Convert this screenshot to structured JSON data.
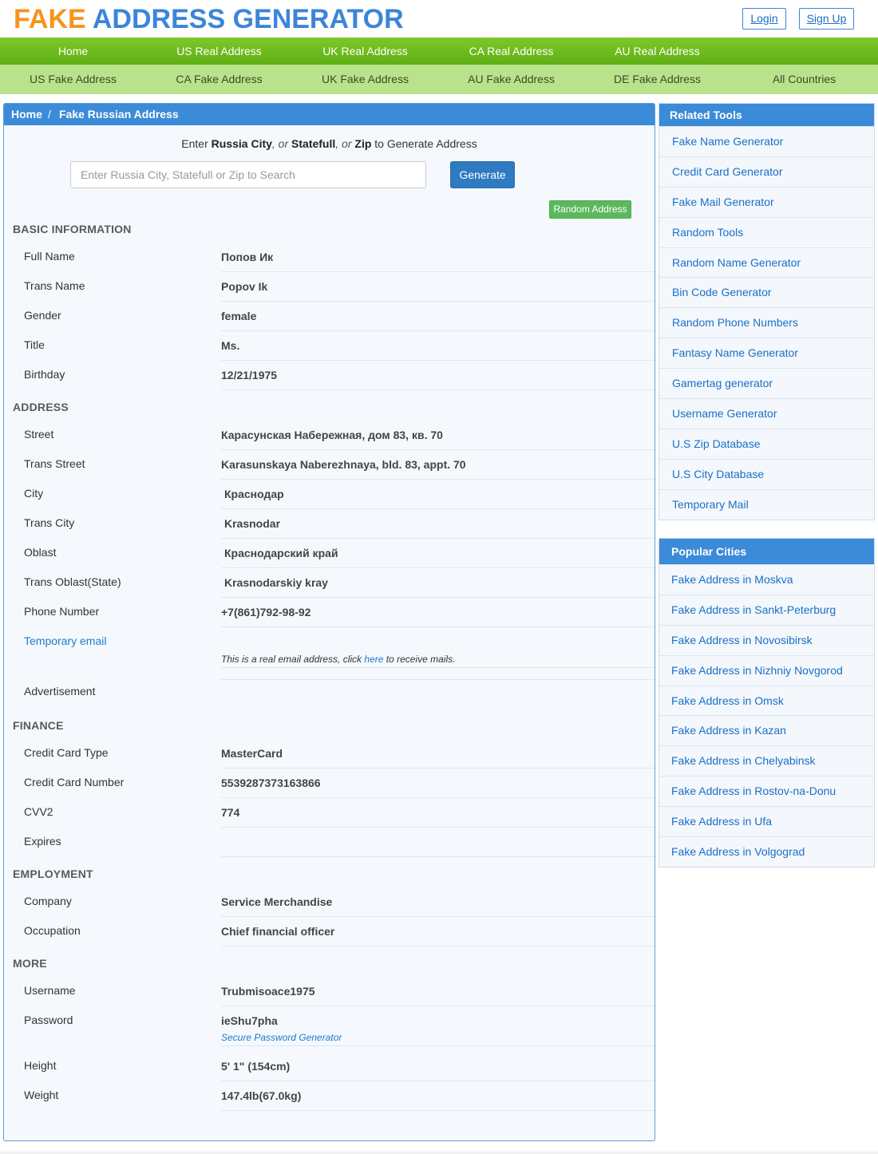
{
  "logo": {
    "word1": "FAKE",
    "word2": "ADDRESS GENERATOR"
  },
  "auth": {
    "login": "Login",
    "signup": "Sign Up"
  },
  "nav_primary": [
    "Home",
    "US Real Address",
    "UK Real Address",
    "CA Real Address",
    "AU Real Address"
  ],
  "nav_secondary": [
    "US Fake Address",
    "CA Fake Address",
    "UK Fake Address",
    "AU Fake Address",
    "DE Fake Address",
    "All Countries"
  ],
  "breadcrumb": {
    "home": "Home",
    "separator": "/",
    "current": "Fake Russian Address"
  },
  "search": {
    "hint_enter": "Enter",
    "hint_city": "Russia City",
    "hint_or1": ", or",
    "hint_state": "Statefull",
    "hint_or2": ", or",
    "hint_zip": "Zip",
    "hint_end": "to Generate Address",
    "placeholder": "Enter Russia City, Statefull or Zip to Search",
    "generate": "Generate",
    "random": "Random Address"
  },
  "basic": {
    "title": "BASIC INFORMATION",
    "rows": [
      {
        "label": "Full Name",
        "value": "Попов Ик"
      },
      {
        "label": "Trans Name",
        "value": "Popov Ik"
      },
      {
        "label": "Gender",
        "value": "female"
      },
      {
        "label": "Title",
        "value": "Ms."
      },
      {
        "label": "Birthday",
        "value": "12/21/1975"
      }
    ]
  },
  "address": {
    "title": "ADDRESS",
    "rows": [
      {
        "label": "Street",
        "value": "Карасунская Набережная, дом 83, кв. 70"
      },
      {
        "label": "Trans Street",
        "value": "Karasunskaya Naberezhnaya, bld. 83, appt. 70"
      },
      {
        "label": "City",
        "value": "Краснодар"
      },
      {
        "label": "Trans City",
        "value": "Krasnodar"
      },
      {
        "label": "Oblast",
        "value": "Краснодарский край"
      },
      {
        "label": "Trans Oblast(State)",
        "value": "Krasnodarskiy kray"
      },
      {
        "label": "Phone Number",
        "value": "+7(861)792-98-92"
      }
    ],
    "temp_email_label": "Temporary email",
    "temp_email_note_pre": "This is a real email address, click",
    "temp_email_note_link": "here",
    "temp_email_note_post": "to receive mails.",
    "advertisement_label": "Advertisement"
  },
  "finance": {
    "title": "FINANCE",
    "rows": [
      {
        "label": "Credit Card Type",
        "value": "MasterCard"
      },
      {
        "label": "Credit Card Number",
        "value": "5539287373163866"
      },
      {
        "label": "CVV2",
        "value": "774"
      },
      {
        "label": "Expires",
        "value": ""
      }
    ]
  },
  "employment": {
    "title": "EMPLOYMENT",
    "rows": [
      {
        "label": "Company",
        "value": "Service Merchandise"
      },
      {
        "label": "Occupation",
        "value": "Chief financial officer"
      }
    ]
  },
  "more": {
    "title": "MORE",
    "username_label": "Username",
    "username_value": "Trubmisoace1975",
    "password_label": "Password",
    "password_value": "ieShu7pha",
    "password_link": "Secure Password Generator",
    "height_label": "Height",
    "height_value": "5' 1\" (154cm)",
    "weight_label": "Weight",
    "weight_value": "147.4lb(67.0kg)"
  },
  "related_tools": {
    "title": "Related Tools",
    "items": [
      "Fake Name Generator",
      "Credit Card Generator",
      "Fake Mail Generator",
      "Random Tools",
      "Random Name Generator",
      "Bin Code Generator",
      "Random Phone Numbers",
      "Fantasy Name Generator",
      "Gamertag generator",
      "Username Generator",
      "U.S Zip Database",
      "U.S City Database",
      "Temporary Mail"
    ]
  },
  "popular_cities": {
    "title": "Popular Cities",
    "items": [
      "Fake Address in Moskva",
      "Fake Address in Sankt-Peterburg",
      "Fake Address in Novosibirsk",
      "Fake Address in Nizhniy Novgorod",
      "Fake Address in Omsk",
      "Fake Address in Kazan",
      "Fake Address in Chelyabinsk",
      "Fake Address in Rostov-na-Donu",
      "Fake Address in Ufa",
      "Fake Address in Volgograd"
    ]
  },
  "colors": {
    "brand_orange": "#f7941d",
    "brand_blue": "#3c85d8",
    "nav_green": "#6fbd1f",
    "nav_light_green": "#b9e38b",
    "panel_blue": "#3b8bd9",
    "link_blue": "#1a6fc7"
  }
}
